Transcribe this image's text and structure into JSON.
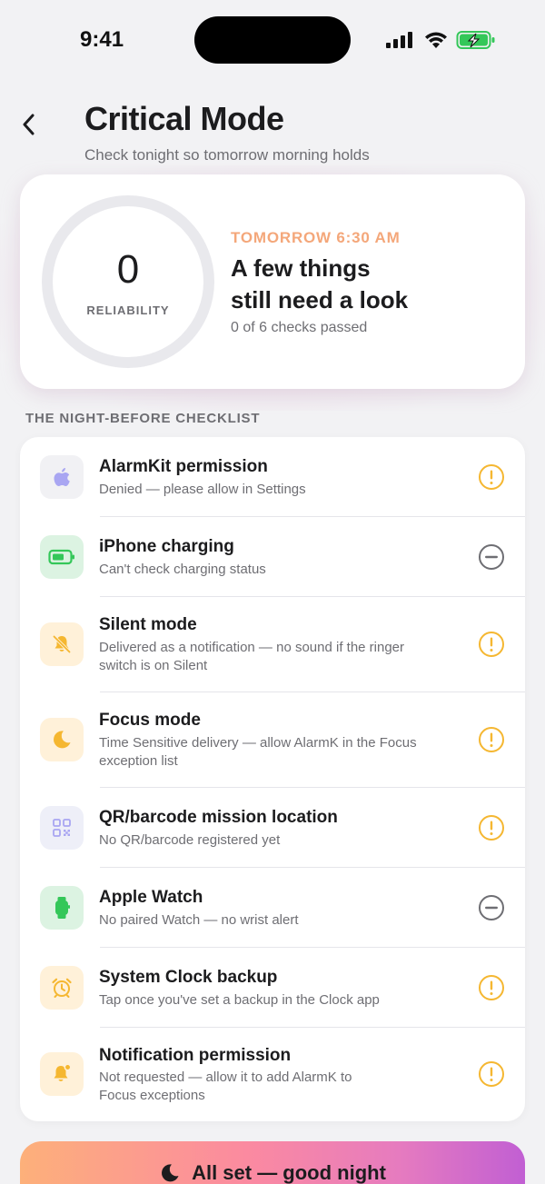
{
  "status_bar": {
    "time": "9:41"
  },
  "header": {
    "title": "Critical Mode",
    "subtitle": "Check tonight so tomorrow morning holds"
  },
  "summary": {
    "reliability_score": "0",
    "reliability_label": "RELIABILITY",
    "alarm_time": "TOMORROW 6:30 AM",
    "headline_line1": "A few things",
    "headline_line2": "still need a look",
    "checks_passed": "0 of 6 checks passed",
    "score_fraction": 0
  },
  "checklist": {
    "section_title": "THE NIGHT-BEFORE CHECKLIST",
    "items": [
      {
        "title": "AlarmKit permission",
        "desc_line1": "Denied — please allow in Settings",
        "desc_line2": "",
        "icon": "apple-icon",
        "status": "warning"
      },
      {
        "title": "iPhone charging",
        "desc_line1": "Can't check charging status",
        "desc_line2": "",
        "icon": "battery-icon",
        "status": "unknown"
      },
      {
        "title": "Silent mode",
        "desc_line1": "Delivered as a notification — no sound if the ringer",
        "desc_line2": "switch is on Silent",
        "icon": "bell-slash-icon",
        "status": "warning"
      },
      {
        "title": "Focus mode",
        "desc_line1": "Time Sensitive delivery — allow AlarmK in the Focus",
        "desc_line2": "exception list",
        "icon": "moon-icon",
        "status": "warning"
      },
      {
        "title": "QR/barcode mission location",
        "desc_line1": "No QR/barcode registered yet",
        "desc_line2": "",
        "icon": "qr-code-icon",
        "status": "warning"
      },
      {
        "title": "Apple Watch",
        "desc_line1": "No paired Watch — no wrist alert",
        "desc_line2": "",
        "icon": "watch-icon",
        "status": "unknown"
      },
      {
        "title": "System Clock backup",
        "desc_line1": "Tap once you've set a backup in the Clock app",
        "desc_line2": "",
        "icon": "alarm-clock-icon",
        "status": "warning"
      },
      {
        "title": "Notification permission",
        "desc_line1": "Not requested — allow it to add AlarmK to",
        "desc_line2": "Focus exceptions",
        "icon": "bell-badge-icon",
        "status": "warning"
      }
    ]
  },
  "cta": {
    "label": "All set — good night"
  },
  "colors": {
    "warning": "#f5b731",
    "unknown": "#6e6e73",
    "accent_orange": "#f4a77a",
    "gradient_start": "#fdb07a",
    "gradient_end": "#c15fd3"
  }
}
